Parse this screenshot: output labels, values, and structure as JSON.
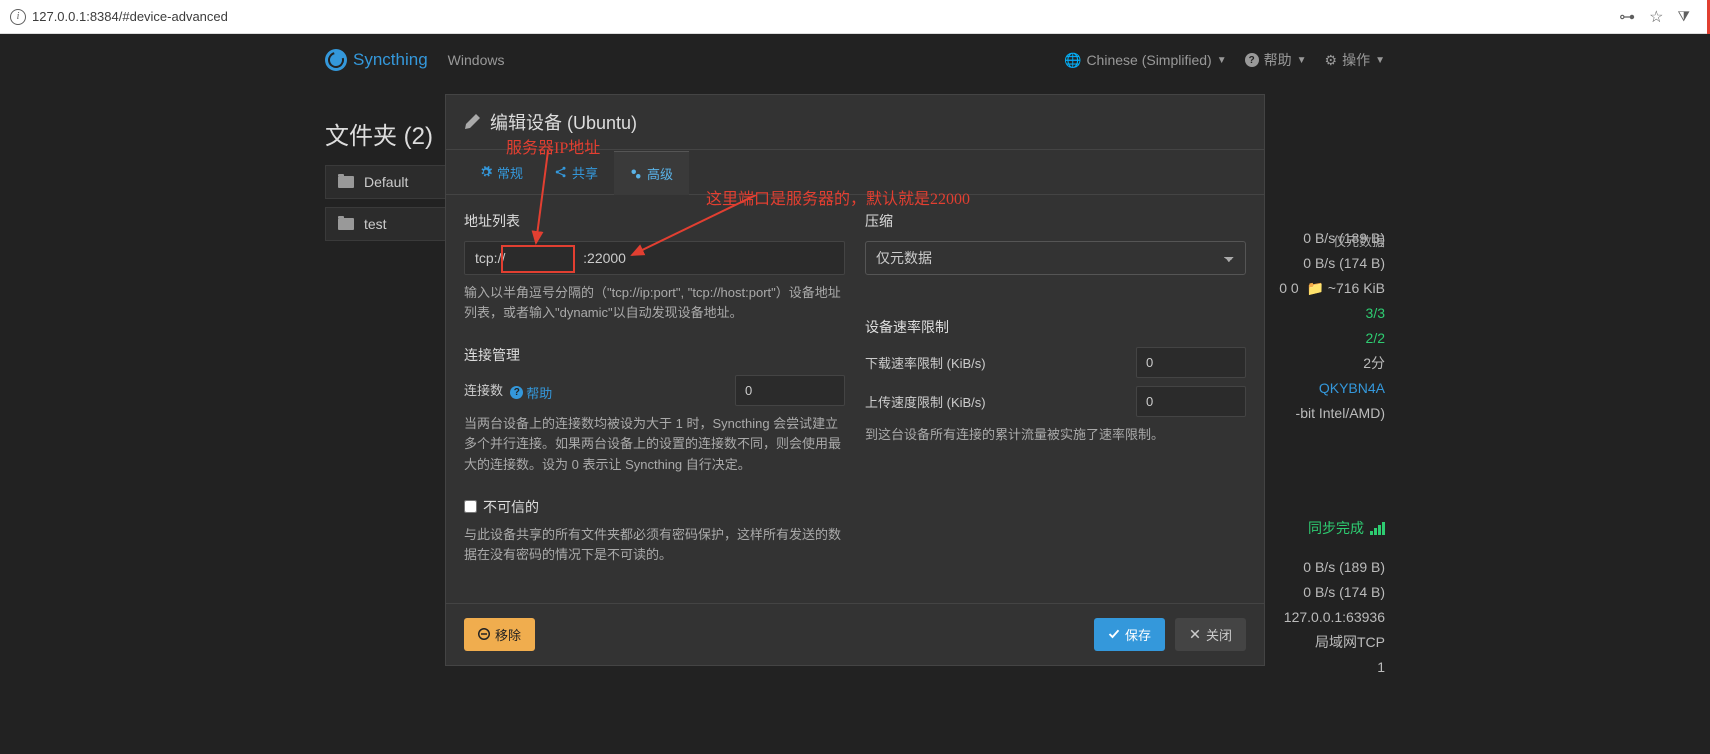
{
  "url": "127.0.0.1:8384/#device-advanced",
  "brand": "Syncthing",
  "nav_left": "Windows",
  "nav_right": {
    "lang": "Chinese (Simplified)",
    "help": "帮助",
    "actions": "操作"
  },
  "folders_title": "文件夹 (2)",
  "folders": [
    "Default",
    "test"
  ],
  "status_right": {
    "r1": "0 B/s (189 B)",
    "r2": "0 B/s (174 B)",
    "r3_left": "0 0",
    "r3_right": "~716 KiB",
    "r4": "3/3",
    "r5": "2/2",
    "r6": "2分",
    "r7": "QKYBN4A",
    "r8": "-bit Intel/AMD)"
  },
  "sync_status": "同步完成",
  "status_lower": {
    "s1": "0 B/s (189 B)",
    "s2": "0 B/s (174 B)",
    "s3": "127.0.0.1:63936",
    "s4": "局域网TCP",
    "s5": "1",
    "bg1_label": "连接数",
    "bg2_label": "压缩",
    "bg2_val": "仅元数据"
  },
  "modal": {
    "title": "编辑设备 (Ubuntu)",
    "tabs": {
      "general": "常规",
      "sharing": "共享",
      "advanced": "高级"
    },
    "addr_label": "地址列表",
    "addr_value": "tcp://                    :22000",
    "addr_help": "输入以半角逗号分隔的（\"tcp://ip:port\", \"tcp://host:port\"）设备地址列表，或者输入\"dynamic\"以自动发现设备地址。",
    "compress_label": "压缩",
    "compress_value": "仅元数据",
    "conn_label": "连接管理",
    "conn_count_label": "连接数",
    "conn_help_link": "帮助",
    "conn_count_value": "0",
    "conn_help": "当两台设备上的连接数均被设为大于 1 时，Syncthing 会尝试建立多个并行连接。如果两台设备上的设置的连接数不同，则会使用最大的连接数。设为 0 表示让 Syncthing 自行决定。",
    "rate_label": "设备速率限制",
    "dl_label": "下载速率限制 (KiB/s)",
    "dl_value": "0",
    "ul_label": "上传速度限制 (KiB/s)",
    "ul_value": "0",
    "rate_help": "到这台设备所有连接的累计流量被实施了速率限制。",
    "untrusted_label": "不可信的",
    "untrusted_help": "与此设备共享的所有文件夹都必须有密码保护，这样所有发送的数据在没有密码的情况下是不可读的。",
    "btn_delete": "移除",
    "btn_save": "保存",
    "btn_close": "关闭"
  },
  "annotations": {
    "a1": "服务器IP地址",
    "a2": "这里端口是服务器的，默认就是22000"
  }
}
